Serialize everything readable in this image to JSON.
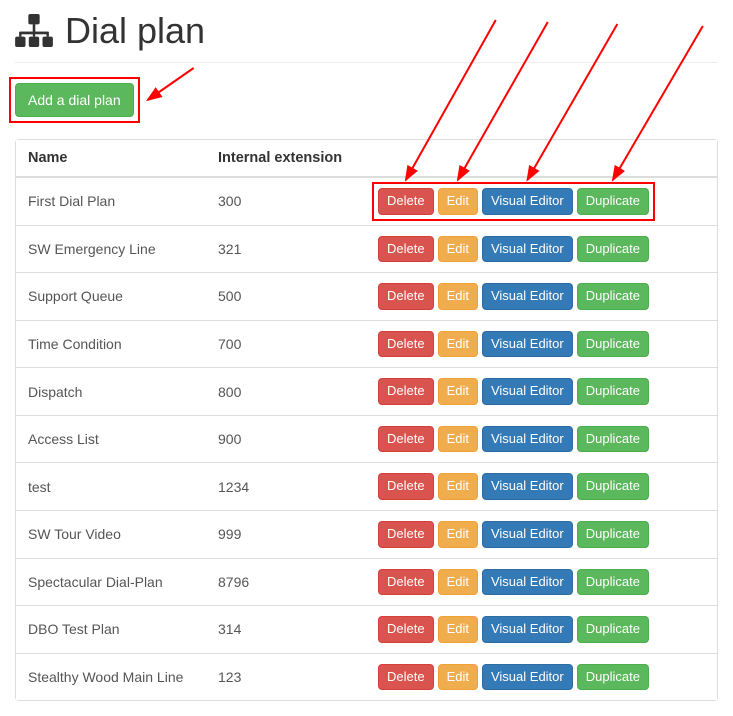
{
  "page": {
    "title": "Dial plan"
  },
  "toolbar": {
    "add_label": "Add a dial plan"
  },
  "table": {
    "headers": {
      "name": "Name",
      "ext": "Internal extension"
    },
    "action_labels": {
      "delete": "Delete",
      "edit": "Edit",
      "visual": "Visual Editor",
      "duplicate": "Duplicate"
    },
    "rows": [
      {
        "name": "First Dial Plan",
        "ext": "300"
      },
      {
        "name": "SW Emergency Line",
        "ext": "321"
      },
      {
        "name": "Support Queue",
        "ext": "500"
      },
      {
        "name": "Time Condition",
        "ext": "700"
      },
      {
        "name": "Dispatch",
        "ext": "800"
      },
      {
        "name": "Access List",
        "ext": "900"
      },
      {
        "name": "test",
        "ext": "1234"
      },
      {
        "name": "SW Tour Video",
        "ext": "999"
      },
      {
        "name": "Spectacular Dial-Plan",
        "ext": "8796"
      },
      {
        "name": "DBO Test Plan",
        "ext": "314"
      },
      {
        "name": "Stealthy Wood Main Line",
        "ext": "123"
      }
    ]
  },
  "annotations": {
    "add_box": true,
    "action_box": true,
    "arrows": 4
  }
}
